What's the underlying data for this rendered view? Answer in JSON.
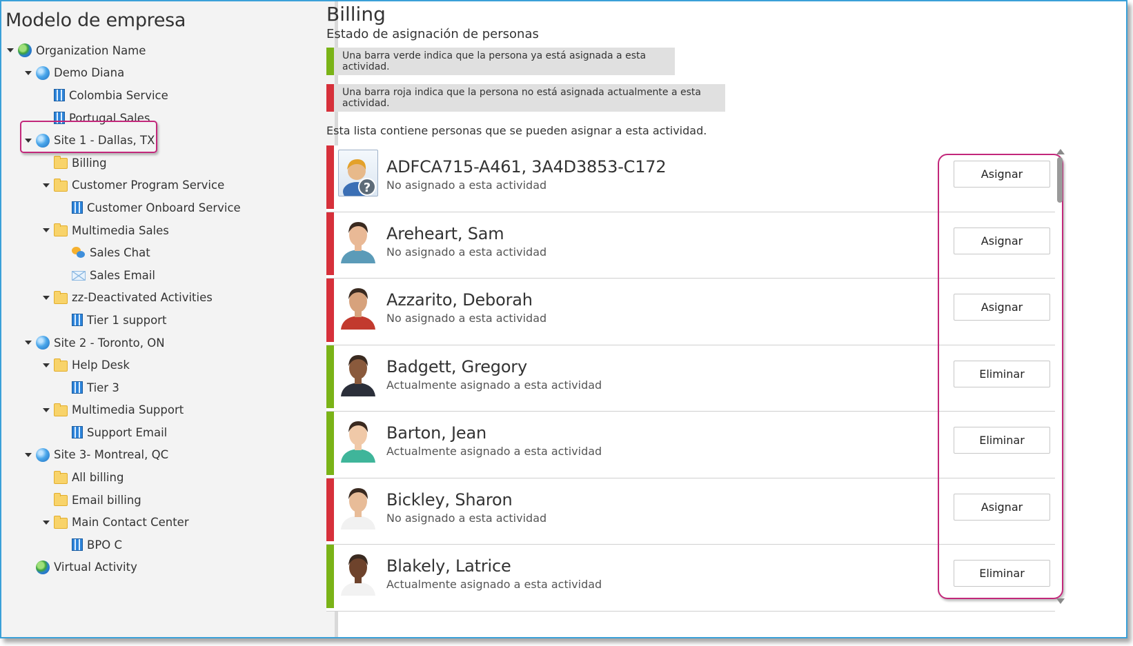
{
  "colors": {
    "assigned": "#7ab317",
    "unassigned": "#d6303a",
    "highlight": "#c2277a",
    "frame": "#3aa0d8"
  },
  "left": {
    "title": "Modelo de empresa",
    "tree": [
      {
        "label": "Organization Name",
        "icon": "org-globe-icon",
        "level": 0,
        "expanded": true
      },
      {
        "label": "Demo Diana",
        "icon": "globe-icon",
        "level": 1,
        "expanded": true
      },
      {
        "label": "Colombia Service",
        "icon": "building-icon",
        "level": 2,
        "expanded": null
      },
      {
        "label": "Portugal Sales",
        "icon": "building-icon",
        "level": 2,
        "expanded": null
      },
      {
        "label": "Site 1 - Dallas, TX",
        "icon": "globe-icon",
        "level": 1,
        "expanded": true
      },
      {
        "label": "Billing",
        "icon": "folder-icon",
        "level": 2,
        "expanded": null
      },
      {
        "label": "Customer Program Service",
        "icon": "folder-icon",
        "level": 2,
        "expanded": true
      },
      {
        "label": "Customer Onboard Service",
        "icon": "building-icon",
        "level": 3,
        "expanded": null
      },
      {
        "label": "Multimedia Sales",
        "icon": "folder-icon",
        "level": 2,
        "expanded": true
      },
      {
        "label": "Sales Chat",
        "icon": "chat-icon",
        "level": 3,
        "expanded": null
      },
      {
        "label": "Sales Email",
        "icon": "mail-icon",
        "level": 3,
        "expanded": null
      },
      {
        "label": "zz-Deactivated Activities",
        "icon": "folder-icon",
        "level": 2,
        "expanded": true
      },
      {
        "label": "Tier 1 support",
        "icon": "building-icon",
        "level": 3,
        "expanded": null
      },
      {
        "label": "Site 2 - Toronto, ON",
        "icon": "globe-icon",
        "level": 1,
        "expanded": true
      },
      {
        "label": "Help Desk",
        "icon": "folder-icon",
        "level": 2,
        "expanded": true
      },
      {
        "label": "Tier 3",
        "icon": "building-icon",
        "level": 3,
        "expanded": null
      },
      {
        "label": "Multimedia Support",
        "icon": "folder-icon",
        "level": 2,
        "expanded": true
      },
      {
        "label": "Support Email",
        "icon": "building-icon",
        "level": 3,
        "expanded": null
      },
      {
        "label": "Site 3- Montreal, QC",
        "icon": "globe-icon",
        "level": 1,
        "expanded": true
      },
      {
        "label": "All billing",
        "icon": "folder-icon",
        "level": 2,
        "expanded": null
      },
      {
        "label": "Email billing",
        "icon": "folder-icon",
        "level": 2,
        "expanded": null
      },
      {
        "label": "Main Contact Center",
        "icon": "folder-icon",
        "level": 2,
        "expanded": true
      },
      {
        "label": "BPO C",
        "icon": "building-icon",
        "level": 3,
        "expanded": null
      },
      {
        "label": "Virtual Activity",
        "icon": "org-globe-icon",
        "level": 1,
        "expanded": null
      }
    ]
  },
  "main": {
    "title": "Billing",
    "subtitle": "Estado de asignación de personas",
    "legend_green": "Una barra verde indica que la persona ya está asignada a esta actividad.",
    "legend_red": "Una barra roja indica que la persona no está asignada actualmente a esta actividad.",
    "list_intro": "Esta lista contiene personas que se pueden asignar a esta actividad.",
    "people": [
      {
        "name": "ADFCA715-A461, 3A4D3853-C172",
        "status": "No asignado a esta actividad",
        "assigned": false,
        "action": "Asignar",
        "avatar": "unknown-person-icon",
        "skin": "#e7b98a",
        "shirt": "#3b6fb5"
      },
      {
        "name": "Areheart, Sam",
        "status": "No asignado a esta actividad",
        "assigned": false,
        "action": "Asignar",
        "avatar": "person-photo",
        "skin": "#e9b996",
        "shirt": "#5b9bb8"
      },
      {
        "name": "Azzarito, Deborah",
        "status": "No asignado a esta actividad",
        "assigned": false,
        "action": "Asignar",
        "avatar": "person-photo",
        "skin": "#d7a27c",
        "shirt": "#c23a2e"
      },
      {
        "name": "Badgett, Gregory",
        "status": "Actualmente asignado a esta actividad",
        "assigned": true,
        "action": "Eliminar",
        "avatar": "person-photo",
        "skin": "#8a5a3c",
        "shirt": "#2b2f3a"
      },
      {
        "name": "Barton, Jean",
        "status": "Actualmente asignado a esta actividad",
        "assigned": true,
        "action": "Eliminar",
        "avatar": "person-photo",
        "skin": "#f0c9a8",
        "shirt": "#3fb59a"
      },
      {
        "name": "Bickley, Sharon",
        "status": "No asignado a esta actividad",
        "assigned": false,
        "action": "Asignar",
        "avatar": "person-photo",
        "skin": "#e8bc98",
        "shirt": "#f1f1f1"
      },
      {
        "name": "Blakely, Latrice",
        "status": "Actualmente asignado a esta actividad",
        "assigned": true,
        "action": "Eliminar",
        "avatar": "person-photo",
        "skin": "#6e432c",
        "shirt": "#f2f2f2"
      }
    ]
  }
}
